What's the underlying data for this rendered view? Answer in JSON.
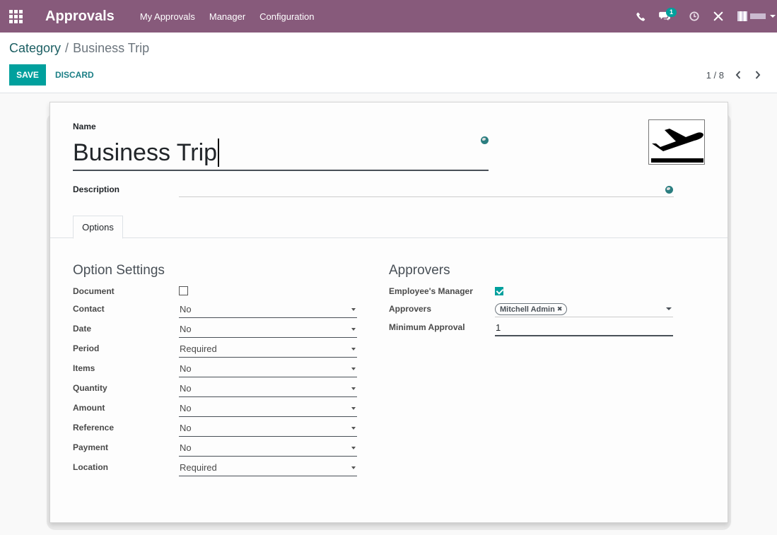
{
  "navbar": {
    "brand": "Approvals",
    "menu": [
      {
        "label": "My Approvals"
      },
      {
        "label": "Manager"
      },
      {
        "label": "Configuration"
      }
    ],
    "messages_count": "1",
    "bg_color": "#875a7b"
  },
  "control_panel": {
    "breadcrumb_parent": "Category",
    "breadcrumb_separator": "/",
    "breadcrumb_current": "Business Trip",
    "save_label": "SAVE",
    "discard_label": "DISCARD",
    "pager": "1 / 8",
    "accent_color": "#00a09d"
  },
  "form": {
    "name_label": "Name",
    "name_value": "Business Trip",
    "description_label": "Description",
    "description_value": "",
    "image_icon": "airplane-departure-icon",
    "tab_options": "Options",
    "option_settings_title": "Option Settings",
    "approvers_title": "Approvers",
    "options": {
      "document": {
        "label": "Document",
        "checked": false
      },
      "fields": [
        {
          "label": "Contact",
          "value": "No"
        },
        {
          "label": "Date",
          "value": "No"
        },
        {
          "label": "Period",
          "value": "Required"
        },
        {
          "label": "Items",
          "value": "No"
        },
        {
          "label": "Quantity",
          "value": "No"
        },
        {
          "label": "Amount",
          "value": "No"
        },
        {
          "label": "Reference",
          "value": "No"
        },
        {
          "label": "Payment",
          "value": "No"
        },
        {
          "label": "Location",
          "value": "Required"
        }
      ]
    },
    "approvers": {
      "employee_manager_label": "Employee's Manager",
      "employee_manager_checked": true,
      "approvers_label": "Approvers",
      "approver_tag": "Mitchell Admin",
      "min_approval_label": "Minimum Approval",
      "min_approval_value": "1"
    }
  }
}
